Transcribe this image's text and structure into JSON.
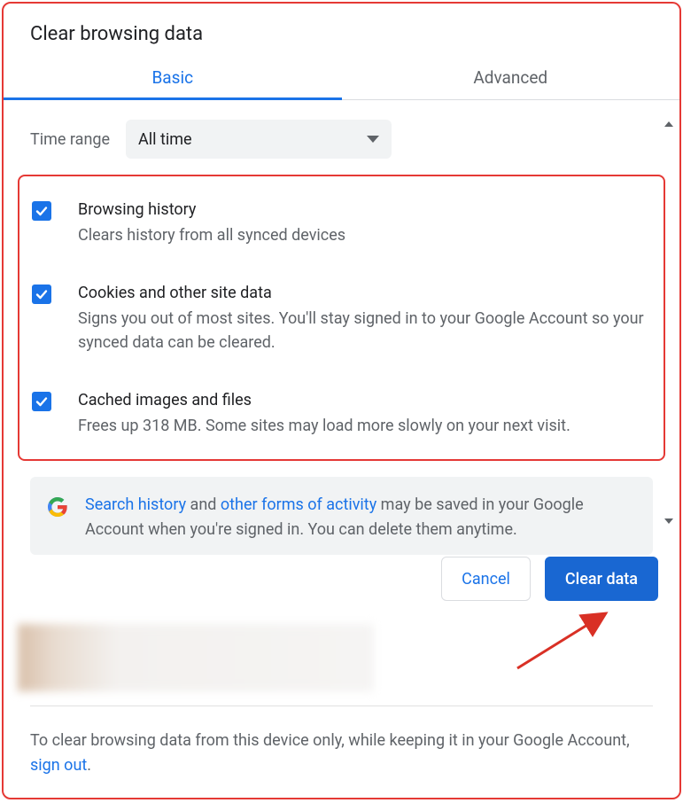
{
  "title": "Clear browsing data",
  "tabs": {
    "basic": "Basic",
    "advanced": "Advanced"
  },
  "time_range": {
    "label": "Time range",
    "value": "All time"
  },
  "items": [
    {
      "title": "Browsing history",
      "desc": "Clears history from all synced devices"
    },
    {
      "title": "Cookies and other site data",
      "desc": "Signs you out of most sites. You'll stay signed in to your Google Account so your synced data can be cleared."
    },
    {
      "title": "Cached images and files",
      "desc": "Frees up 318 MB. Some sites may load more slowly on your next visit."
    }
  ],
  "info": {
    "link1": "Search history",
    "mid1": " and ",
    "link2": "other forms of activity",
    "rest": " may be saved in your Google Account when you're signed in. You can delete them anytime."
  },
  "buttons": {
    "cancel": "Cancel",
    "clear": "Clear data"
  },
  "bottom": {
    "text": "To clear browsing data from this device only, while keeping it in your Google Account, ",
    "link": "sign out",
    "period": "."
  }
}
